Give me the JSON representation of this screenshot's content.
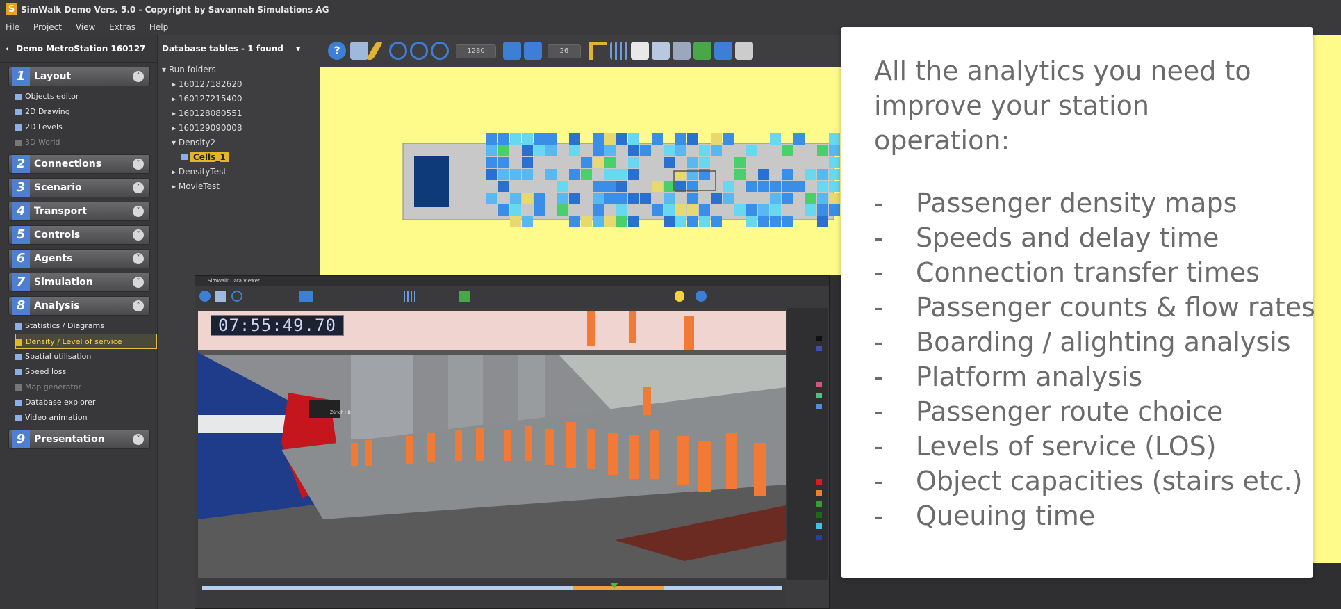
{
  "window": {
    "title": "SimWalk Demo Vers. 5.0 - Copyright by Savannah Simulations AG",
    "logo_letter": "S"
  },
  "menu": [
    "File",
    "Project",
    "View",
    "Extras",
    "Help"
  ],
  "sidebar": {
    "project_name": "Demo MetroStation 160127",
    "sections": [
      {
        "num": "1",
        "label": "Layout",
        "expanded": true,
        "items": [
          {
            "label": "Objects editor"
          },
          {
            "label": "2D Drawing"
          },
          {
            "label": "2D Levels"
          },
          {
            "label": "3D World"
          }
        ]
      },
      {
        "num": "2",
        "label": "Connections"
      },
      {
        "num": "3",
        "label": "Scenario"
      },
      {
        "num": "4",
        "label": "Transport"
      },
      {
        "num": "5",
        "label": "Controls"
      },
      {
        "num": "6",
        "label": "Agents"
      },
      {
        "num": "7",
        "label": "Simulation"
      },
      {
        "num": "8",
        "label": "Analysis",
        "expanded": true,
        "items": [
          {
            "label": "Statistics / Diagrams"
          },
          {
            "label": "Density / Level of service"
          },
          {
            "label": "Spatial utilisation"
          },
          {
            "label": "Speed loss"
          },
          {
            "label": "Map generator"
          },
          {
            "label": "Database explorer"
          },
          {
            "label": "Video animation"
          }
        ]
      },
      {
        "num": "9",
        "label": "Presentation"
      }
    ]
  },
  "db_panel": {
    "title": "Database tables - 1 found",
    "tree": [
      "Run folders",
      "160127182620",
      "160127215400",
      "160128080551",
      "160129090008",
      "Density2",
      "Cells_1",
      "DensityTest",
      "MovieTest"
    ]
  },
  "toolbar": {
    "zoom_value": "1280",
    "level_value": "26"
  },
  "viewer": {
    "title": "SimWalk Data Viewer",
    "clock": "07:55:49.70",
    "train_display": "Zürich HB"
  },
  "card": {
    "heading": "All the analytics you need to improve your station operation:",
    "items": [
      "Passenger density maps",
      "Speeds and delay time",
      "Connection transfer times",
      "Passenger counts & flow rates",
      "Boarding / alighting analysis",
      "Platform analysis",
      "Passenger route choice",
      "Levels of service (LOS)",
      "Object capacities (stairs etc.)",
      "Queuing time"
    ],
    "bullet": "-"
  },
  "colors": {
    "accent": "#4e7fd0",
    "canvas": "#fffb8a",
    "highlight": "#e3b528",
    "card_text": "#6b6b6b"
  }
}
